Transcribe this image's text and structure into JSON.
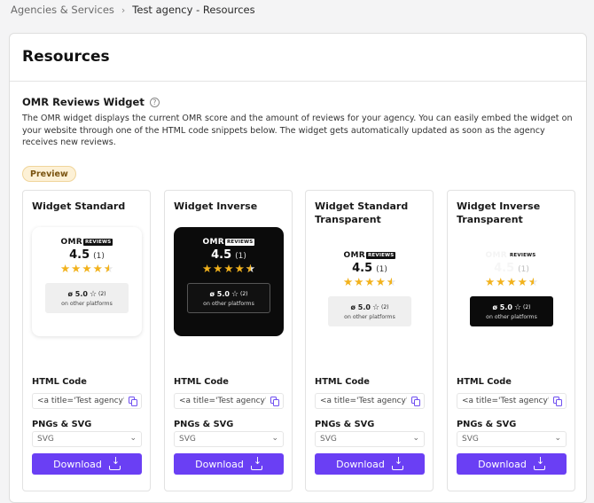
{
  "breadcrumb": {
    "parent": "Agencies & Services",
    "separator": "›",
    "current": "Test agency - Resources"
  },
  "page": {
    "title": "Resources"
  },
  "widget_section": {
    "title": "OMR Reviews Widget",
    "help_icon": "?",
    "description": "The OMR widget displays the current OMR score and the amount of reviews for your agency. You can easily embed the widget on your website through one of the HTML code snippets below. The widget gets automatically updated as soon as the agency receives new reviews.",
    "preview_badge": "Preview"
  },
  "widget_content": {
    "logo_omr": "OMR",
    "logo_reviews": "REVIEWS",
    "score": "4.5",
    "count": "(1)",
    "rating_stars": 4.5,
    "stars": {
      "s1": "★",
      "s2": "★",
      "s3": "★",
      "s4": "★",
      "s5": "★"
    },
    "platform_score": "ø 5.0",
    "platform_star": "☆",
    "platform_count": "(2)",
    "platform_label": "on other platforms"
  },
  "cards": [
    {
      "title": "Widget Standard",
      "variant": "standard",
      "html_code_label": "HTML Code",
      "code_value": "<a title='Test agency' hr",
      "pngs_label": "PNGs & SVG",
      "select_value": "SVG",
      "download_label": "Download"
    },
    {
      "title": "Widget Inverse",
      "variant": "inverse",
      "html_code_label": "HTML Code",
      "code_value": "<a title='Test agency' hr",
      "pngs_label": "PNGs & SVG",
      "select_value": "SVG",
      "download_label": "Download"
    },
    {
      "title": "Widget Standard Transparent",
      "variant": "transparent",
      "html_code_label": "HTML Code",
      "code_value": "<a title='Test agency' hr",
      "pngs_label": "PNGs & SVG",
      "select_value": "SVG",
      "download_label": "Download"
    },
    {
      "title": "Widget Inverse Transparent",
      "variant": "inverse-transparent",
      "html_code_label": "HTML Code",
      "code_value": "<a title='Test agency' hr",
      "pngs_label": "PNGs & SVG",
      "select_value": "SVG",
      "download_label": "Download"
    }
  ],
  "icons": {
    "help": "help-circle-icon",
    "copy": "copy-icon",
    "chevron": "chevron-down-icon",
    "download": "download-icon",
    "star": "star-icon"
  },
  "colors": {
    "accent": "#6a3ff4",
    "star": "#f2b21c",
    "badge_bg": "#fdf1d6",
    "inverse_bg": "#0b0b0b"
  }
}
